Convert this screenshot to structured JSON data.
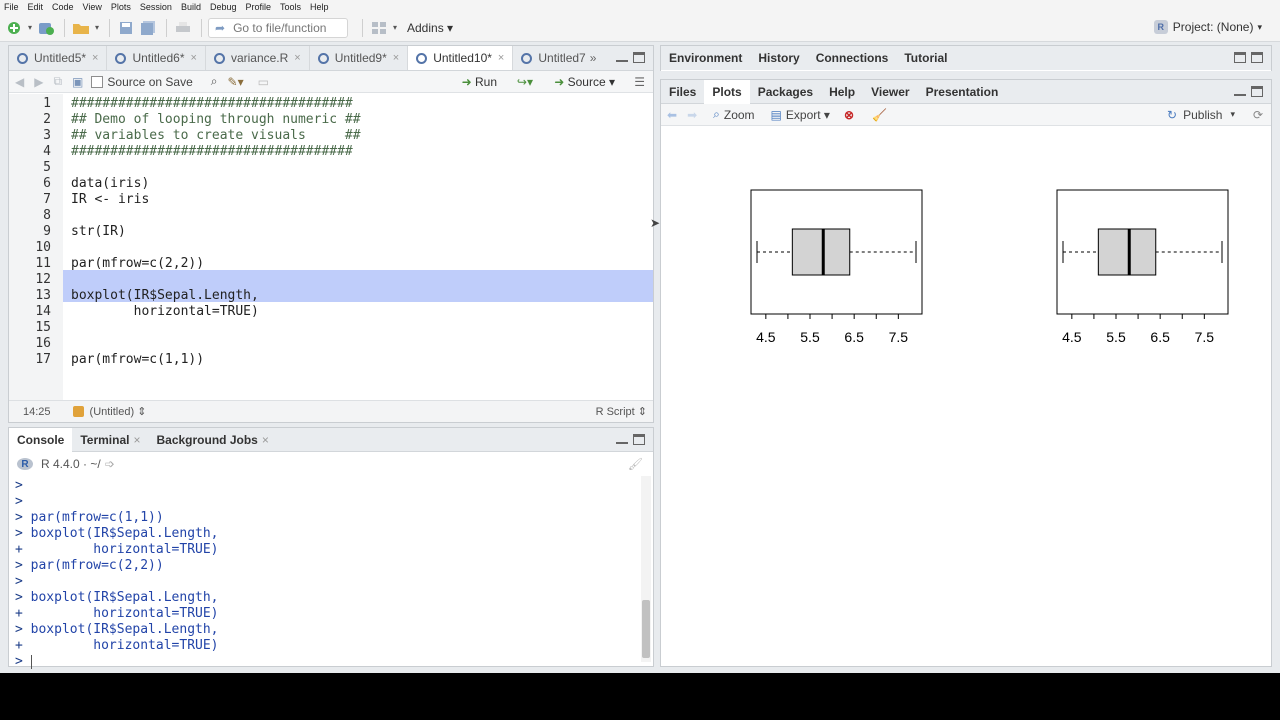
{
  "menu": [
    "File",
    "Edit",
    "Code",
    "View",
    "Plots",
    "Session",
    "Build",
    "Debug",
    "Profile",
    "Tools",
    "Help"
  ],
  "toolbar": {
    "goto_placeholder": "Go to file/function",
    "addins_label": "Addins",
    "project_label": "Project: (None)"
  },
  "source": {
    "tabs": [
      {
        "label": "Untitled5*",
        "active": false
      },
      {
        "label": "Untitled6*",
        "active": false
      },
      {
        "label": "variance.R",
        "active": false
      },
      {
        "label": "Untitled9*",
        "active": false
      },
      {
        "label": "Untitled10*",
        "active": true
      },
      {
        "label": "Untitled7",
        "active": false
      }
    ],
    "source_on_save": "Source on Save",
    "run_label": "Run",
    "source_label": "Source",
    "lines": [
      {
        "n": "1",
        "text": "####################################",
        "comment": true
      },
      {
        "n": "2",
        "text": "## Demo of looping through numeric ##",
        "comment": true
      },
      {
        "n": "3",
        "text": "## variables to create visuals     ##",
        "comment": true
      },
      {
        "n": "4",
        "text": "####################################",
        "comment": true
      },
      {
        "n": "5",
        "text": ""
      },
      {
        "n": "6",
        "text": "data(iris)"
      },
      {
        "n": "7",
        "text": "IR <- iris"
      },
      {
        "n": "8",
        "text": ""
      },
      {
        "n": "9",
        "text": "str(IR)"
      },
      {
        "n": "10",
        "text": ""
      },
      {
        "n": "11",
        "text": "par(mfrow=c(2,2))"
      },
      {
        "n": "12",
        "text": ""
      },
      {
        "n": "13",
        "text": "boxplot(IR$Sepal.Length,"
      },
      {
        "n": "14",
        "text": "        horizontal=TRUE)"
      },
      {
        "n": "15",
        "text": ""
      },
      {
        "n": "16",
        "text": ""
      },
      {
        "n": "17",
        "text": "par(mfrow=c(1,1))"
      }
    ],
    "status_pos": "14:25",
    "status_scope": "(Untitled)",
    "status_type": "R Script"
  },
  "console": {
    "tabs": [
      "Console",
      "Terminal",
      "Background Jobs"
    ],
    "r_version": "R 4.4.0 · ~/",
    "lines": [
      {
        "p": ">",
        "t": ""
      },
      {
        "p": ">",
        "t": ""
      },
      {
        "p": ">",
        "t": "par(mfrow=c(1,1))"
      },
      {
        "p": ">",
        "t": "boxplot(IR$Sepal.Length,"
      },
      {
        "p": "+",
        "t": "        horizontal=TRUE)"
      },
      {
        "p": ">",
        "t": "par(mfrow=c(2,2))"
      },
      {
        "p": ">",
        "t": ""
      },
      {
        "p": ">",
        "t": "boxplot(IR$Sepal.Length,"
      },
      {
        "p": "+",
        "t": "        horizontal=TRUE)"
      },
      {
        "p": ">",
        "t": "boxplot(IR$Sepal.Length,"
      },
      {
        "p": "+",
        "t": "        horizontal=TRUE)"
      },
      {
        "p": ">",
        "t": ""
      }
    ]
  },
  "env_pane": {
    "tabs": [
      "Environment",
      "History",
      "Connections",
      "Tutorial"
    ]
  },
  "files_pane": {
    "tabs": [
      "Files",
      "Plots",
      "Packages",
      "Help",
      "Viewer",
      "Presentation"
    ],
    "active_tab": "Plots",
    "zoom_label": "Zoom",
    "export_label": "Export",
    "publish_label": "Publish"
  },
  "chart_data": [
    {
      "type": "boxplot",
      "orientation": "horizontal",
      "xlim": [
        4.3,
        7.9
      ],
      "ticks": [
        "4.5",
        "5.5",
        "6.5",
        "7.5"
      ],
      "tick_values": [
        4.5,
        5.0,
        5.5,
        6.0,
        6.5,
        7.0,
        7.5
      ],
      "min": 4.3,
      "q1": 5.1,
      "median": 5.8,
      "q3": 6.4,
      "max": 7.9
    },
    {
      "type": "boxplot",
      "orientation": "horizontal",
      "xlim": [
        4.3,
        7.9
      ],
      "ticks": [
        "4.5",
        "5.5",
        "6.5",
        "7.5"
      ],
      "tick_values": [
        4.5,
        5.0,
        5.5,
        6.0,
        6.5,
        7.0,
        7.5
      ],
      "min": 4.3,
      "q1": 5.1,
      "median": 5.8,
      "q3": 6.4,
      "max": 7.9
    }
  ]
}
